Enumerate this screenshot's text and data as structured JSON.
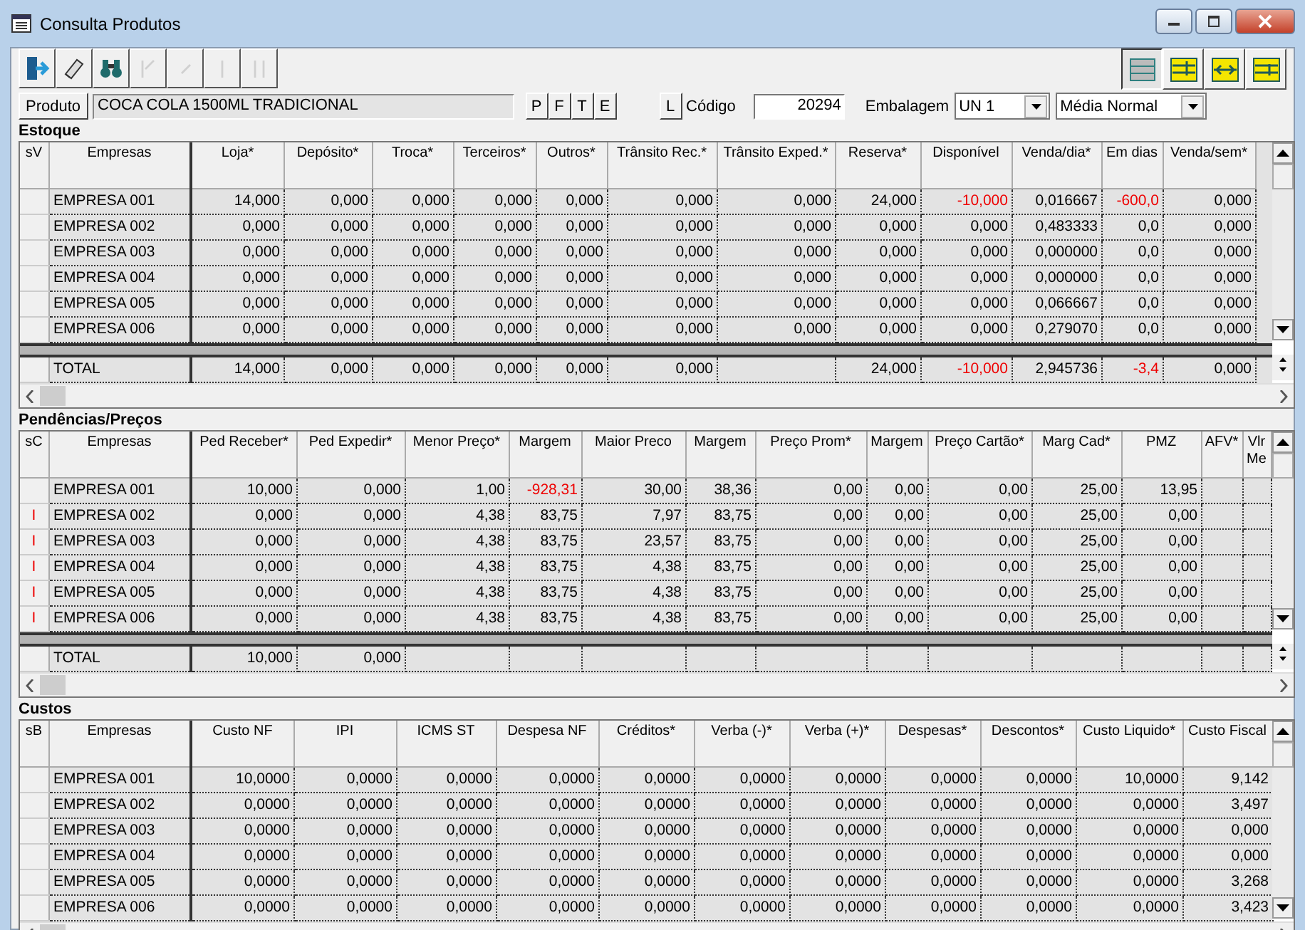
{
  "window": {
    "title": "Consulta Produtos"
  },
  "toolbar": {
    "left_buttons": [
      {
        "kind": "exit",
        "disabled": false
      },
      {
        "kind": "eraser",
        "disabled": false
      },
      {
        "kind": "binoculars",
        "disabled": false
      },
      {
        "kind": "first",
        "disabled": true
      },
      {
        "kind": "previous",
        "disabled": true
      },
      {
        "kind": "next",
        "disabled": true
      },
      {
        "kind": "last",
        "disabled": true
      }
    ],
    "view_buttons": [
      {
        "kind": "list",
        "selected": true
      },
      {
        "kind": "top",
        "selected": false
      },
      {
        "kind": "columns",
        "selected": false
      },
      {
        "kind": "bottom",
        "selected": false
      }
    ]
  },
  "product": {
    "button": "Produto",
    "name": "COCA COLA 1500ML TRADICIONAL",
    "letter_buttons": [
      "P",
      "F",
      "T",
      "E"
    ],
    "l_button": "L",
    "code_label": "Código",
    "code": "20294",
    "packaging_label": "Embalagem",
    "packaging": "UN  1",
    "average": "Média Normal"
  },
  "sections": [
    {
      "title": "Estoque",
      "indicator_label": "sV",
      "columns": [
        "Empresas",
        "Loja*",
        "Depósito*",
        "Troca*",
        "Terceiros*",
        "Outros*",
        "Trânsito Rec.*",
        "Trânsito Exped.*",
        "Reserva*",
        "Disponível",
        "Venda/dia*",
        "Em dias",
        "Venda/sem*"
      ],
      "rows": [
        {
          "cells": [
            "EMPRESA 001",
            "14,000",
            "0,000",
            "0,000",
            "0,000",
            "0,000",
            "0,000",
            "0,000",
            "24,000",
            "-10,000",
            "0,016667",
            "-600,0",
            "0,000"
          ]
        },
        {
          "cells": [
            "EMPRESA 002",
            "0,000",
            "0,000",
            "0,000",
            "0,000",
            "0,000",
            "0,000",
            "0,000",
            "0,000",
            "0,000",
            "0,483333",
            "0,0",
            "0,000"
          ]
        },
        {
          "cells": [
            "EMPRESA 003",
            "0,000",
            "0,000",
            "0,000",
            "0,000",
            "0,000",
            "0,000",
            "0,000",
            "0,000",
            "0,000",
            "0,000000",
            "0,0",
            "0,000"
          ]
        },
        {
          "cells": [
            "EMPRESA 004",
            "0,000",
            "0,000",
            "0,000",
            "0,000",
            "0,000",
            "0,000",
            "0,000",
            "0,000",
            "0,000",
            "0,000000",
            "0,0",
            "0,000"
          ]
        },
        {
          "cells": [
            "EMPRESA 005",
            "0,000",
            "0,000",
            "0,000",
            "0,000",
            "0,000",
            "0,000",
            "0,000",
            "0,000",
            "0,000",
            "0,066667",
            "0,0",
            "0,000"
          ]
        },
        {
          "cells": [
            "EMPRESA 006",
            "0,000",
            "0,000",
            "0,000",
            "0,000",
            "0,000",
            "0,000",
            "0,000",
            "0,000",
            "0,000",
            "0,279070",
            "0,0",
            "0,000"
          ]
        }
      ],
      "total": [
        {
          "value": "TOTAL"
        },
        {
          "value": "14,000"
        },
        {
          "value": "0,000"
        },
        {
          "value": "0,000"
        },
        {
          "value": "0,000"
        },
        {
          "value": "0,000"
        },
        {
          "value": "0,000"
        },
        {
          "value": "24,000",
          "blank_before": true
        },
        {
          "value": "-10,000"
        },
        {
          "value": "2,945736"
        },
        {
          "value": "-3,4"
        },
        {
          "value": "0,000"
        }
      ]
    },
    {
      "title": "Pendências/Preços",
      "indicator_label": "sC",
      "columns": [
        "Empresas",
        "Ped Receber*",
        "Ped Expedir*",
        "Menor Preço*",
        "Margem",
        "Maior Preco",
        "Margem",
        "Preço Prom*",
        "Margem",
        "Preço Cartão*",
        "Marg Cad*",
        "PMZ",
        "AFV*",
        "Vlr Me"
      ],
      "rows": [
        {
          "cells": [
            "EMPRESA 001",
            "10,000",
            "0,000",
            "1,00",
            "-928,31",
            "30,00",
            "38,36",
            "0,00",
            "0,00",
            "0,00",
            "25,00",
            "13,95"
          ]
        },
        {
          "flag": "I",
          "cells": [
            "EMPRESA 002",
            "0,000",
            "0,000",
            "4,38",
            "83,75",
            "7,97",
            "83,75",
            "0,00",
            "0,00",
            "0,00",
            "25,00",
            "0,00"
          ]
        },
        {
          "flag": "I",
          "cells": [
            "EMPRESA 003",
            "0,000",
            "0,000",
            "4,38",
            "83,75",
            "23,57",
            "83,75",
            "0,00",
            "0,00",
            "0,00",
            "25,00",
            "0,00"
          ]
        },
        {
          "flag": "I",
          "cells": [
            "EMPRESA 004",
            "0,000",
            "0,000",
            "4,38",
            "83,75",
            "4,38",
            "83,75",
            "0,00",
            "0,00",
            "0,00",
            "25,00",
            "0,00"
          ]
        },
        {
          "flag": "I",
          "cells": [
            "EMPRESA 005",
            "0,000",
            "0,000",
            "4,38",
            "83,75",
            "4,38",
            "83,75",
            "0,00",
            "0,00",
            "0,00",
            "25,00",
            "0,00"
          ]
        },
        {
          "flag": "I",
          "cells": [
            "EMPRESA 006",
            "0,000",
            "0,000",
            "4,38",
            "83,75",
            "4,38",
            "83,75",
            "0,00",
            "0,00",
            "0,00",
            "25,00",
            "0,00"
          ]
        }
      ],
      "total": [
        {
          "value": "TOTAL"
        },
        {
          "value": "10,000"
        },
        {
          "value": "0,000"
        }
      ]
    },
    {
      "title": "Custos",
      "indicator_label": "sB",
      "columns": [
        "Empresas",
        "Custo NF",
        "IPI",
        "ICMS ST",
        "Despesa NF",
        "Créditos*",
        "Verba (-)*",
        "Verba (+)*",
        "Despesas*",
        "Descontos*",
        "Custo Liquido*",
        "Custo Fiscal"
      ],
      "rows": [
        {
          "cells": [
            "EMPRESA 001",
            "10,0000",
            "0,0000",
            "0,0000",
            "0,0000",
            "0,0000",
            "0,0000",
            "0,0000",
            "0,0000",
            "0,0000",
            "10,0000",
            "9,142"
          ]
        },
        {
          "cells": [
            "EMPRESA 002",
            "0,0000",
            "0,0000",
            "0,0000",
            "0,0000",
            "0,0000",
            "0,0000",
            "0,0000",
            "0,0000",
            "0,0000",
            "0,0000",
            "3,497"
          ]
        },
        {
          "cells": [
            "EMPRESA 003",
            "0,0000",
            "0,0000",
            "0,0000",
            "0,0000",
            "0,0000",
            "0,0000",
            "0,0000",
            "0,0000",
            "0,0000",
            "0,0000",
            "0,000"
          ]
        },
        {
          "cells": [
            "EMPRESA 004",
            "0,0000",
            "0,0000",
            "0,0000",
            "0,0000",
            "0,0000",
            "0,0000",
            "0,0000",
            "0,0000",
            "0,0000",
            "0,0000",
            "0,000"
          ]
        },
        {
          "cells": [
            "EMPRESA 005",
            "0,0000",
            "0,0000",
            "0,0000",
            "0,0000",
            "0,0000",
            "0,0000",
            "0,0000",
            "0,0000",
            "0,0000",
            "0,0000",
            "3,268"
          ]
        },
        {
          "cells": [
            "EMPRESA 006",
            "0,0000",
            "0,0000",
            "0,0000",
            "0,0000",
            "0,0000",
            "0,0000",
            "0,0000",
            "0,0000",
            "0,0000",
            "0,0000",
            "3,423"
          ]
        }
      ]
    }
  ]
}
